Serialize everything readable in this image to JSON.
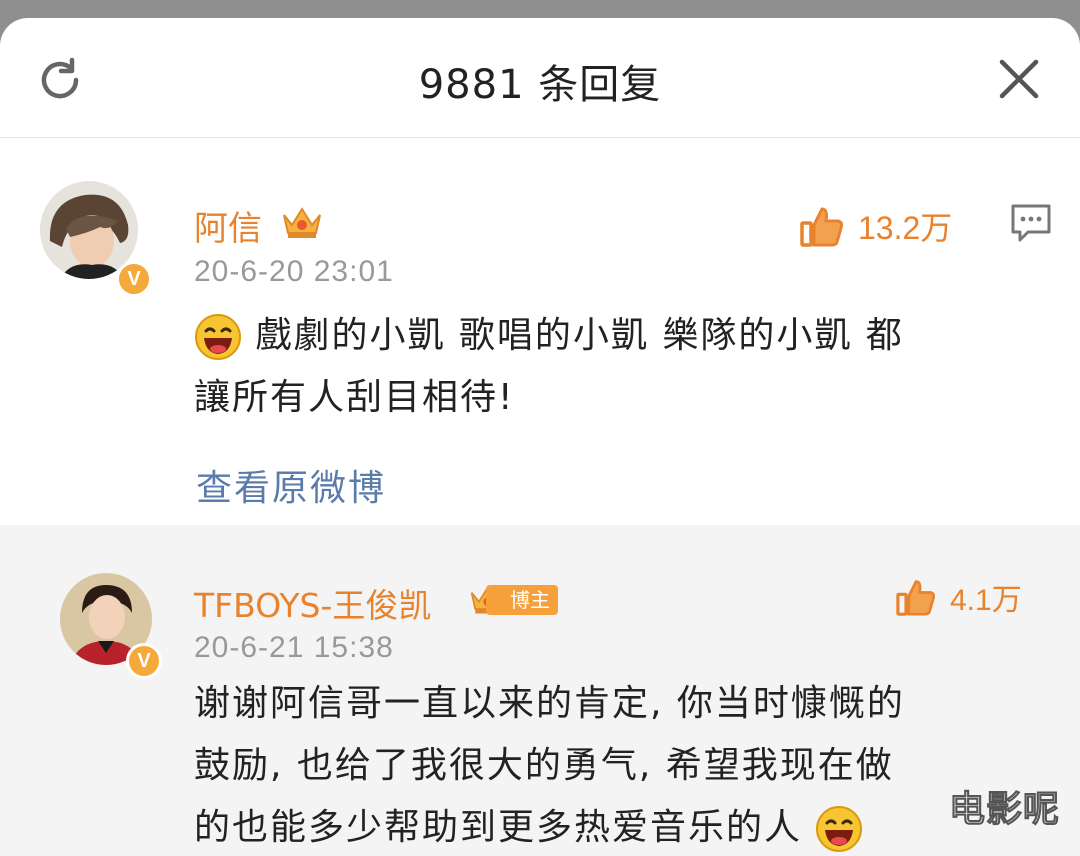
{
  "header": {
    "title": "9881 条回复"
  },
  "main_comment": {
    "username": "阿信",
    "timestamp": "20-6-20 23:01",
    "likes": "13.2万",
    "text_line1": "戲劇的小凱  歌唱的小凱  樂隊的小凱   都",
    "text_line2": "讓所有人刮目相待!",
    "view_original": "查看原微博",
    "verified_badge": "V"
  },
  "reply": {
    "username": "TFBOYS-王俊凯",
    "tag": "博主",
    "timestamp": "20-6-21 15:38",
    "likes": "4.1万",
    "text_line1": "谢谢阿信哥一直以来的肯定, 你当时慷慨的",
    "text_line2": "鼓励, 也给了我很大的勇气, 希望我现在做",
    "text_line3": "的也能多少帮助到更多热爱音乐的人",
    "verified_badge": "V"
  },
  "watermark": "电影呢",
  "colors": {
    "accent_orange": "#e8822d",
    "link_blue": "#5b7bab",
    "timestamp_gray": "#999999",
    "badge_orange": "#f4a93a"
  },
  "icons": {
    "refresh": "refresh-icon",
    "close": "close-icon",
    "like": "thumbs-up-icon",
    "reply": "comment-bubble-icon",
    "crown": "crown-icon",
    "emoji": "laughing-emoji-icon"
  }
}
